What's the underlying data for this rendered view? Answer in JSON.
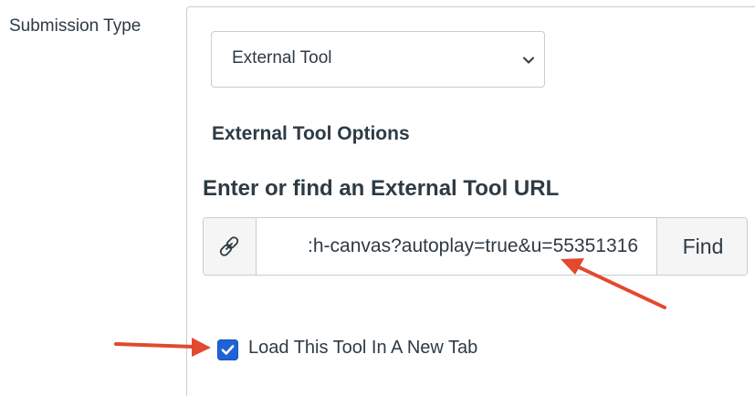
{
  "submission_type_label": "Submission Type",
  "submission_select": {
    "value": "External Tool"
  },
  "external_tool_options_heading": "External Tool Options",
  "url_section": {
    "heading": "Enter or find an External Tool URL",
    "url_value": ":h-canvas?autoplay=true&u=55351316",
    "find_label": "Find",
    "prefix_icon": "link-icon"
  },
  "new_tab_option": {
    "label": "Load This Tool In A New Tab",
    "checked": true
  },
  "annotations": {
    "arrow_color": "#e2492f"
  },
  "colors": {
    "checkbox_accent": "#1f63d6",
    "text": "#2d3b45",
    "border": "#c7cdd1"
  }
}
